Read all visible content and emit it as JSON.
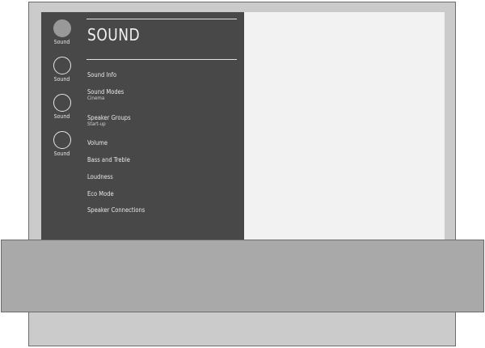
{
  "rail": {
    "items": [
      {
        "label": "Sound",
        "active": true,
        "icon": "circle-icon"
      },
      {
        "label": "Sound",
        "active": false,
        "icon": "circle-icon"
      },
      {
        "label": "Sound",
        "active": false,
        "icon": "circle-icon"
      },
      {
        "label": "Sound",
        "active": false,
        "icon": "circle-icon"
      }
    ]
  },
  "panel": {
    "title": "SOUND",
    "menu": [
      {
        "label": "Sound Info",
        "sub": ""
      },
      {
        "label": "Sound Modes",
        "sub": "Cinema"
      },
      {
        "label": "Speaker Groups",
        "sub": "Start-up"
      },
      {
        "label": "Volume",
        "sub": ""
      },
      {
        "label": "Bass and Treble",
        "sub": ""
      },
      {
        "label": "Loudness",
        "sub": ""
      },
      {
        "label": "Eco Mode",
        "sub": ""
      },
      {
        "label": "Speaker Connections",
        "sub": ""
      }
    ]
  },
  "colors": {
    "panel_bg": "#484848",
    "screen_bg": "#f2f2f2",
    "frame_bg": "#cbcbcb",
    "bar_bg": "#a9a9a9",
    "active_indicator": "#999999"
  }
}
